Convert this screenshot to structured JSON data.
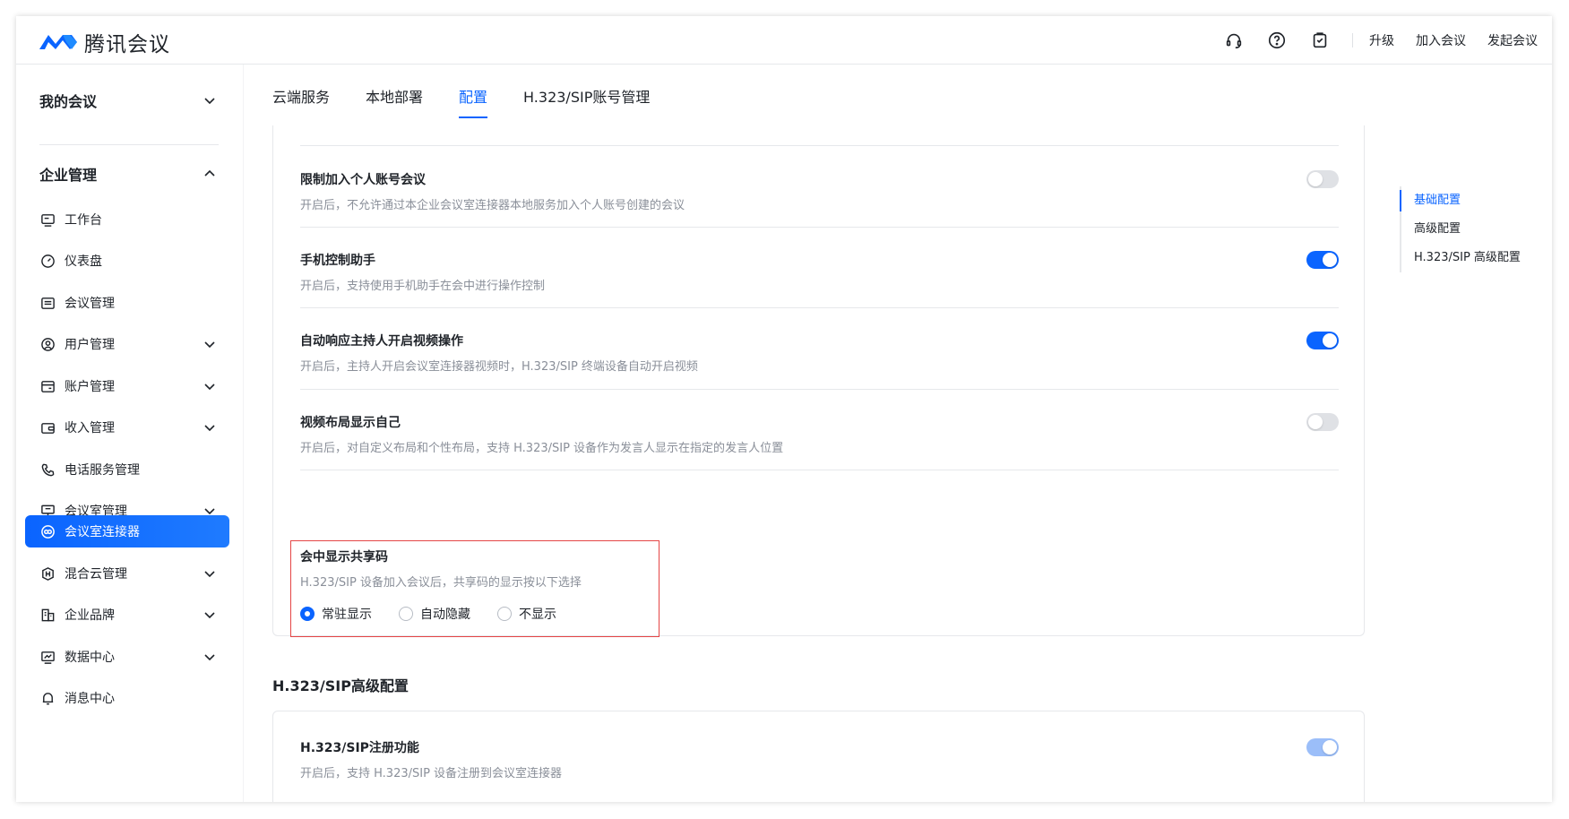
{
  "app": {
    "name": "腾讯会议",
    "brand_color": "#0a64ff"
  },
  "header": {
    "icons": [
      "headset-icon",
      "help-icon",
      "clipboard-icon"
    ],
    "links": {
      "upgrade": "升级",
      "join": "加入会议",
      "start": "发起会议"
    }
  },
  "sidebar": {
    "my_meetings": "我的会议",
    "enterprise": "企业管理",
    "items": [
      {
        "label": "工作台",
        "icon": "workbench-icon",
        "expandable": false
      },
      {
        "label": "仪表盘",
        "icon": "dashboard-icon",
        "expandable": false
      },
      {
        "label": "会议管理",
        "icon": "meeting-list-icon",
        "expandable": false
      },
      {
        "label": "用户管理",
        "icon": "user-icon",
        "expandable": true
      },
      {
        "label": "账户管理",
        "icon": "account-icon",
        "expandable": true
      },
      {
        "label": "收入管理",
        "icon": "wallet-icon",
        "expandable": true
      },
      {
        "label": "电话服务管理",
        "icon": "phone-icon",
        "expandable": false
      },
      {
        "label": "会议室管理",
        "icon": "room-icon",
        "expandable": true
      },
      {
        "label": "会议室连接器",
        "icon": "connector-icon",
        "expandable": false,
        "active": true
      },
      {
        "label": "混合云管理",
        "icon": "hybrid-cloud-icon",
        "expandable": true
      },
      {
        "label": "企业品牌",
        "icon": "brand-icon",
        "expandable": true
      },
      {
        "label": "数据中心",
        "icon": "data-icon",
        "expandable": true
      },
      {
        "label": "消息中心",
        "icon": "bell-icon",
        "expandable": false
      }
    ]
  },
  "tabs": [
    "云端服务",
    "本地部署",
    "配置",
    "H.323/SIP账号管理"
  ],
  "active_tab": "配置",
  "settings": [
    {
      "title": "限制加入个人账号会议",
      "desc": "开启后，不允许通过本企业会议室连接器本地服务加入个人账号创建的会议",
      "enabled": false
    },
    {
      "title": "手机控制助手",
      "desc": "开启后，支持使用手机助手在会中进行操作控制",
      "enabled": true
    },
    {
      "title": "自动响应主持人开启视频操作",
      "desc": "开启后，主持人开启会议室连接器视频时，H.323/SIP 终端设备自动开启视频",
      "enabled": true
    },
    {
      "title": "视频布局显示自己",
      "desc": "开启后，对自定义布局和个性布局，支持 H.323/SIP 设备作为发言人显示在指定的发言人位置",
      "enabled": false
    }
  ],
  "share_code": {
    "title": "会中显示共享码",
    "desc": "H.323/SIP 设备加入会议后，共享码的显示按以下选择",
    "options": [
      "常驻显示",
      "自动隐藏",
      "不显示"
    ],
    "selected": "常驻显示"
  },
  "sip_section": {
    "heading": "H.323/SIP高级配置",
    "title": "H.323/SIP注册功能",
    "desc": "开启后，支持 H.323/SIP 设备注册到会议室连接器",
    "enabled": true
  },
  "anchor_nav": [
    "基础配置",
    "高级配置",
    "H.323/SIP 高级配置"
  ],
  "anchor_active": "基础配置"
}
